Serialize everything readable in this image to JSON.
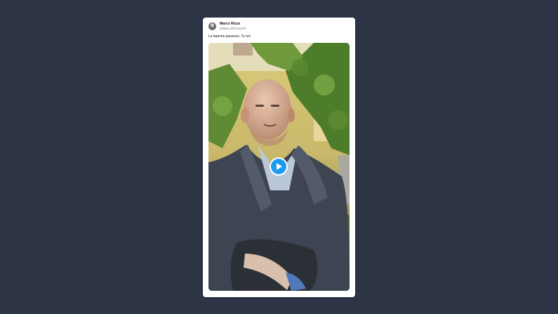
{
  "tweet": {
    "display_name": "Marco Rizzo",
    "handle": "@MarcoRizzoDSP",
    "text": "Le banche possono. Tu no!"
  },
  "media": {
    "type": "video",
    "play_icon": "play-icon"
  },
  "colors": {
    "background": "#2c3446",
    "card": "#ffffff",
    "play_button": "#1d9bf0"
  }
}
